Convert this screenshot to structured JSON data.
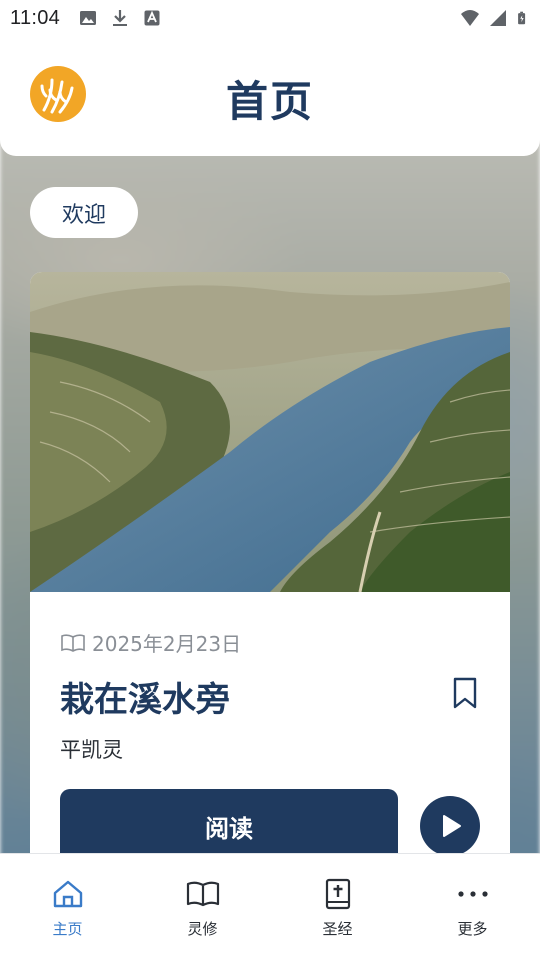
{
  "status_bar": {
    "time": "11:04",
    "left_icons": [
      "image-icon",
      "download-icon",
      "font-icon"
    ],
    "right_icons": [
      "wifi-icon",
      "signal-icon",
      "battery-icon"
    ]
  },
  "header": {
    "title": "首页",
    "logo": "wheat-logo",
    "brand_color": "#F2A626"
  },
  "welcome": {
    "label": "欢迎"
  },
  "devotional_card": {
    "date": "2025年2月23日",
    "title": "栽在溪水旁",
    "author": "平凯灵",
    "read_label": "阅读",
    "bookmark_icon": "bookmark-icon",
    "play_icon": "play-icon"
  },
  "bottom_nav": {
    "items": [
      {
        "label": "主页",
        "icon": "home-icon",
        "active": true
      },
      {
        "label": "灵修",
        "icon": "open-book-icon",
        "active": false
      },
      {
        "label": "圣经",
        "icon": "bible-icon",
        "active": false
      },
      {
        "label": "更多",
        "icon": "more-icon",
        "active": false
      }
    ]
  },
  "colors": {
    "primary": "#1F3A5F",
    "accent": "#3A7BC8",
    "muted": "#8A8F96"
  }
}
